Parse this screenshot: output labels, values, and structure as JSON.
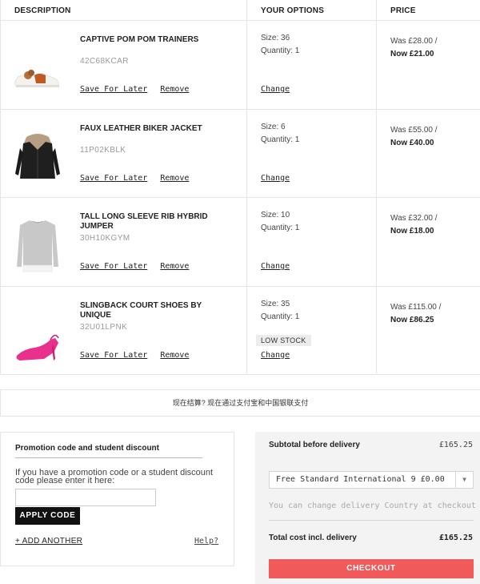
{
  "table_headers": {
    "description": "DESCRIPTION",
    "options": "YOUR OPTIONS",
    "price": "PRICE"
  },
  "items": [
    {
      "name": "CAPTIVE POM POM TRAINERS",
      "code": "42C68KCAR",
      "size": "Size: 36",
      "quantity": "Quantity: 1",
      "was": "Was £28.00 /",
      "now": "Now £21.00",
      "save_later": "Save For Later",
      "remove": "Remove",
      "change": "Change",
      "image_icon": "trainers-image"
    },
    {
      "name": "FAUX LEATHER BIKER JACKET",
      "code": "11P02KBLK",
      "size": "Size: 6",
      "quantity": "Quantity: 1",
      "was": "Was £55.00 /",
      "now": "Now £40.00",
      "save_later": "Save For Later",
      "remove": "Remove",
      "change": "Change",
      "image_icon": "jacket-image"
    },
    {
      "name": "TALL LONG SLEEVE RIB HYBRID JUMPER",
      "code": "30H10KGYM",
      "size": "Size: 10",
      "quantity": "Quantity: 1",
      "was": "Was £32.00 /",
      "now": "Now £18.00",
      "save_later": "Save For Later",
      "remove": "Remove",
      "change": "Change",
      "image_icon": "jumper-image"
    },
    {
      "name": "SLINGBACK COURT SHOES BY UNIQUE",
      "code": "32U01LPNK",
      "size": "Size: 35",
      "quantity": "Quantity: 1",
      "low_stock": "LOW STOCK",
      "was": "Was £115.00 /",
      "now": "Now £86.25",
      "save_later": "Save For Later",
      "remove": "Remove",
      "change": "Change",
      "image_icon": "court-shoe-image"
    }
  ],
  "payment_bar": "现在结算? 现在通过支付宝和中国银联支付",
  "promo": {
    "title": "Promotion code and student discount",
    "text": "If you have a promotion code or a student discount code please enter it here:",
    "input_value": "",
    "apply_label": "APPLY CODE",
    "add_another": "+ ADD ANOTHER",
    "help": "Help?"
  },
  "summary": {
    "subtotal_label": "Subtotal before delivery",
    "subtotal_value": "£165.25",
    "delivery_option": "Free Standard International 9 £0.00",
    "delivery_note": "You can change delivery Country at checkout",
    "total_label": "Total cost incl. delivery",
    "total_value": "£165.25",
    "checkout_label": "CHECKOUT"
  },
  "colors": {
    "checkout": "#f05a5a",
    "apply": "#111111",
    "shoe_pink": "#e8308c"
  }
}
